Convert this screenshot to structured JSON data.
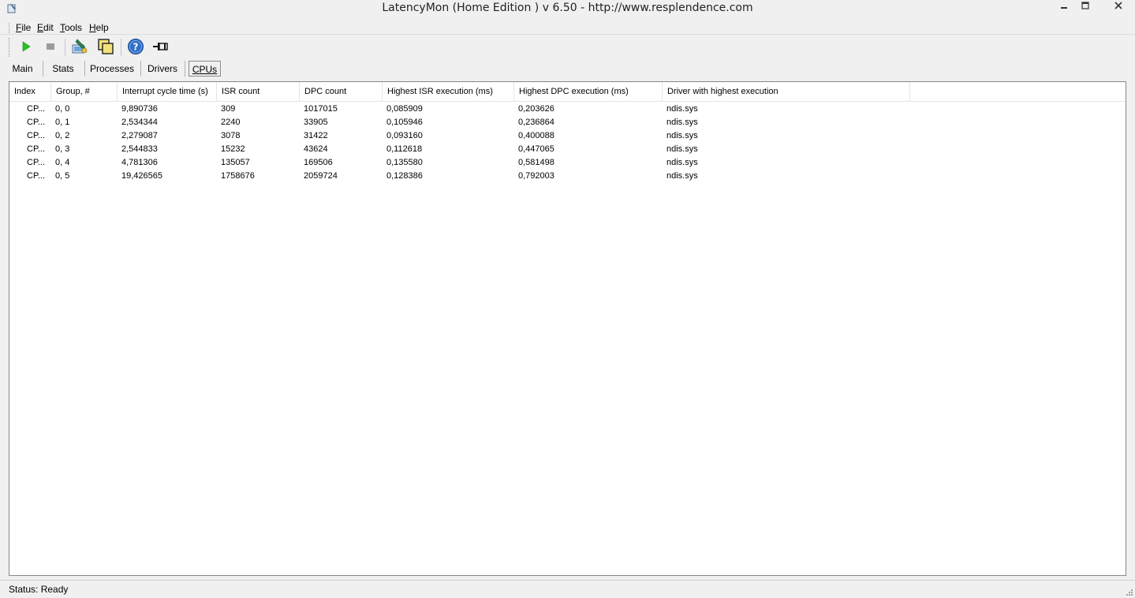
{
  "window": {
    "title": "LatencyMon  (Home Edition )  v 6.50 - http://www.resplendence.com"
  },
  "menu": {
    "items": [
      {
        "label": "File",
        "accel": "F",
        "rest": "ile"
      },
      {
        "label": "Edit",
        "accel": "E",
        "rest": "dit"
      },
      {
        "label": "Tools",
        "accel": "T",
        "rest": "ools"
      },
      {
        "label": "Help",
        "accel": "H",
        "rest": "elp"
      }
    ]
  },
  "toolbar": {
    "icons": [
      "play-icon",
      "stop-icon",
      "analyze-icon",
      "windows-icon",
      "help-icon",
      "pin-icon"
    ]
  },
  "tabs": [
    {
      "label": "Main",
      "active": false
    },
    {
      "label": "Stats",
      "active": false
    },
    {
      "label": "Processes",
      "active": false
    },
    {
      "label": "Drivers",
      "active": false
    },
    {
      "label": "CPUs",
      "active": true
    }
  ],
  "table": {
    "columns": [
      "Index",
      "Group, #",
      "Interrupt cycle time (s)",
      "ISR count",
      "DPC count",
      "Highest ISR execution (ms)",
      "Highest DPC execution (ms)",
      "Driver with highest execution"
    ],
    "rows": [
      [
        "CP...",
        "0, 0",
        "9,890736",
        "309",
        "1017015",
        "0,085909",
        "0,203626",
        "ndis.sys"
      ],
      [
        "CP...",
        "0, 1",
        "2,534344",
        "2240",
        "33905",
        "0,105946",
        "0,236864",
        "ndis.sys"
      ],
      [
        "CP...",
        "0, 2",
        "2,279087",
        "3078",
        "31422",
        "0,093160",
        "0,400088",
        "ndis.sys"
      ],
      [
        "CP...",
        "0, 3",
        "2,544833",
        "15232",
        "43624",
        "0,112618",
        "0,447065",
        "ndis.sys"
      ],
      [
        "CP...",
        "0, 4",
        "4,781306",
        "135057",
        "169506",
        "0,135580",
        "0,581498",
        "ndis.sys"
      ],
      [
        "CP...",
        "0, 5",
        "19,426565",
        "1758676",
        "2059724",
        "0,128386",
        "0,792003",
        "ndis.sys"
      ]
    ]
  },
  "status": {
    "text": "Status: Ready"
  }
}
